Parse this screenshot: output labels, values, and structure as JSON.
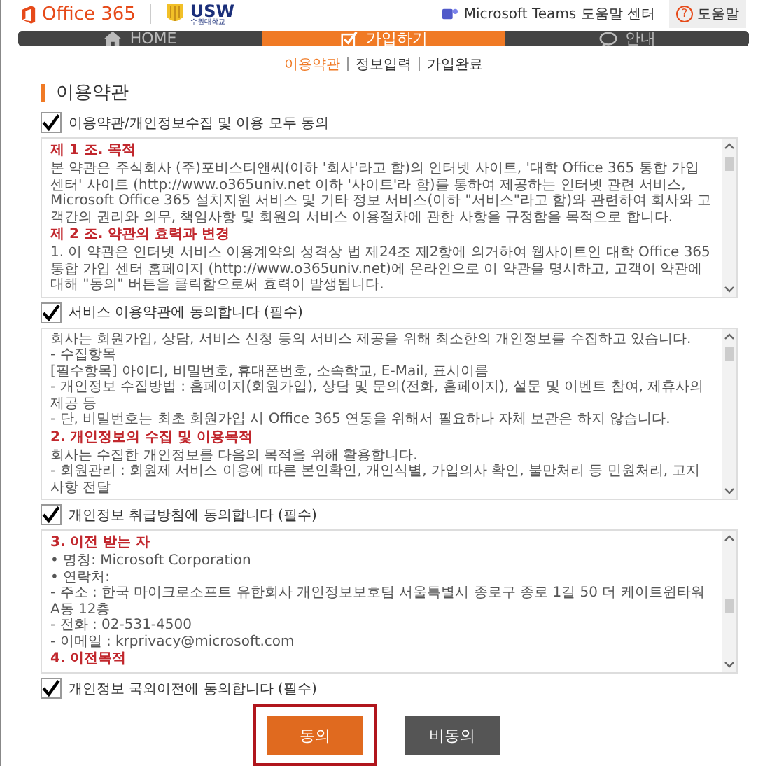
{
  "header": {
    "brand": "Office 365",
    "school_logo": "USW",
    "school_name": "수원대학교",
    "teams_link": "Microsoft Teams 도움말 센터",
    "help_mark": "?",
    "help_button": "도움말"
  },
  "nav": [
    {
      "label": "HOME",
      "selected": false
    },
    {
      "label": "가입하기",
      "selected": true
    },
    {
      "label": "안내",
      "selected": false
    }
  ],
  "steps": [
    {
      "label": "이용약관",
      "selected": true
    },
    {
      "label": "정보입력",
      "selected": false
    },
    {
      "label": "가입완료",
      "selected": false
    }
  ],
  "page_title": "이용약관",
  "agree_all": {
    "label": "이용약관/개인정보수집 및 이용 모두 동의",
    "checked": true
  },
  "sections": [
    {
      "box": [
        {
          "kind": "heading",
          "text": "제 1 조. 목적"
        },
        {
          "kind": "text",
          "text": "본 약관은 주식회사 (주)포비스티앤씨(이하 '회사'라고 함)의 인터넷 사이트, '대학 Office 365 통합 가입 센터' 사이트 (http://www.o365univ.net 이하 '사이트'라 함)를 통하여 제공하는 인터넷 관련 서비스, Microsoft Office 365 설치지원 서비스 및 기타 정보 서비스(이하 \"서비스\"라고 함)와 관련하여 회사와 고객간의 권리와 의무, 책임사항 및 회원의 서비스 이용절차에 관한 사항을 규정함을 목적으로 합니다."
        },
        {
          "kind": "heading",
          "text": "제 2 조. 약관의 효력과 변경"
        },
        {
          "kind": "text",
          "text": "1. 이 약관은 인터넷 서비스 이용계약의 성격상 법 제24조 제2항에 의거하여 웹사이트인 대학 Office 365 통합 가입 센터 홈페이지 (http://www.o365univ.net)에 온라인으로 이 약관을 명시하고, 고객이 약관에 대해 \"동의\" 버튼을 클릭함으로써 효력이 발생됩니다."
        }
      ],
      "agree": {
        "label": "서비스 이용약관에 동의합니다 (필수)",
        "checked": true
      }
    },
    {
      "box": [
        {
          "kind": "text",
          "text": "회사는 회원가입, 상담, 서비스 신청 등의 서비스 제공을 위해 최소한의 개인정보를 수집하고 있습니다."
        },
        {
          "kind": "text",
          "text": "- 수집항목"
        },
        {
          "kind": "text",
          "text": "[필수항목] 아이디, 비밀번호, 휴대폰번호, 소속학교, E-Mail, 표시이름"
        },
        {
          "kind": "text",
          "text": "- 개인정보 수집방법 : 홈페이지(회원가입), 상담 및 문의(전화, 홈페이지), 설문 및 이벤트 참여, 제휴사의 제공 등"
        },
        {
          "kind": "text",
          "text": "- 단, 비밀번호는 최초 회원가입 시 Office 365 연동을 위해서 필요하나 자체 보관은 하지 않습니다."
        },
        {
          "kind": "heading",
          "text": "2. 개인정보의 수집 및 이용목적"
        },
        {
          "kind": "text",
          "text": "회사는 수집한 개인정보를 다음의 목적을 위해 활용합니다."
        },
        {
          "kind": "text",
          "text": "- 회원관리 : 회원제 서비스 이용에 따른 본인확인, 개인식별, 가입의사 확인, 불만처리 등 민원처리, 고지사항 전달"
        }
      ],
      "agree": {
        "label": "개인정보 취급방침에 동의합니다 (필수)",
        "checked": true
      }
    },
    {
      "box": [
        {
          "kind": "heading",
          "text": "3. 이전 받는 자"
        },
        {
          "kind": "text",
          "text": "• 명칭: Microsoft Corporation"
        },
        {
          "kind": "text",
          "text": "• 연락처:"
        },
        {
          "kind": "text",
          "text": "- 주소 : 한국 마이크로소프트 유한회사 개인정보보호팀 서울특별시 종로구 종로 1길 50 더 케이트윈타워 A동 12층"
        },
        {
          "kind": "text",
          "text": "- 전화 : 02-531-4500"
        },
        {
          "kind": "text",
          "text": "- 이메일 : krprivacy@microsoft.com"
        },
        {
          "kind": "heading",
          "text": "4. 이전목적"
        }
      ],
      "agree": {
        "label": "개인정보 국외이전에 동의합니다 (필수)",
        "checked": true
      }
    }
  ],
  "buttons": [
    {
      "label": "동의",
      "kind": "primary",
      "focused": true
    },
    {
      "label": "비동의",
      "kind": "secondary",
      "focused": false
    }
  ]
}
